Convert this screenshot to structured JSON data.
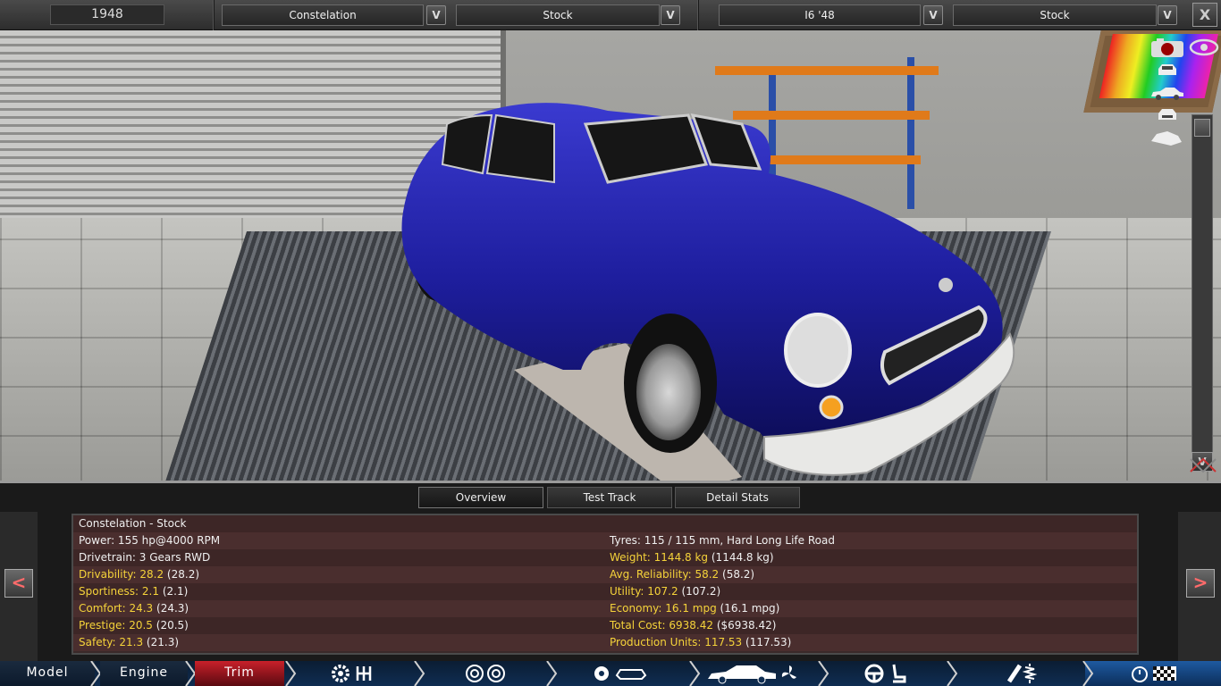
{
  "topbar": {
    "year": "1948",
    "model": "Constelation",
    "model_trim": "Stock",
    "engine": "I6 '48",
    "engine_variant": "Stock",
    "dropdown_glyph": "V",
    "close_glyph": "X"
  },
  "camera_tools": {
    "icons": [
      "camera-icon",
      "car-front-view-icon",
      "car-side-view-icon",
      "car-rear-view-icon",
      "car-angled-view-icon"
    ],
    "scroll_down": "V"
  },
  "tabs": [
    "Overview",
    "Test Track",
    "Detail Stats"
  ],
  "active_tab": "Overview",
  "nav_prev": "<",
  "nav_next": ">",
  "stats": {
    "title": "Constelation - Stock",
    "left": [
      {
        "label": "Power: 155 hp@4000 RPM",
        "value": "",
        "highlight": false
      },
      {
        "label": "Drivetrain: 3 Gears RWD",
        "value": "",
        "highlight": false
      },
      {
        "label": "Drivability: 28.2",
        "value": "(28.2)",
        "highlight": true
      },
      {
        "label": "Sportiness: 2.1",
        "value": "(2.1)",
        "highlight": true
      },
      {
        "label": "Comfort: 24.3",
        "value": "(24.3)",
        "highlight": true
      },
      {
        "label": "Prestige: 20.5",
        "value": "(20.5)",
        "highlight": true
      },
      {
        "label": "Safety: 21.3",
        "value": "(21.3)",
        "highlight": true
      }
    ],
    "right": [
      {
        "label": "Tyres: 115 / 115 mm, Hard Long Life Road",
        "value": "",
        "highlight": false
      },
      {
        "label": "Weight: 1144.8 kg",
        "value": "(1144.8 kg)",
        "highlight": true
      },
      {
        "label": "Avg. Reliability: 58.2",
        "value": "(58.2)",
        "highlight": true
      },
      {
        "label": "Utility: 107.2",
        "value": "(107.2)",
        "highlight": true
      },
      {
        "label": "Economy: 16.1 mpg",
        "value": "(16.1 mpg)",
        "highlight": true
      },
      {
        "label": "Total Cost: 6938.42",
        "value": "($6938.42)",
        "highlight": true
      },
      {
        "label": "Production Units: 117.53",
        "value": "(117.53)",
        "highlight": true
      }
    ]
  },
  "nav": {
    "tabs": [
      "Model",
      "Engine",
      "Trim"
    ],
    "active": "Trim",
    "icon_groups": [
      [
        "gear-icon",
        "gearbox-icon"
      ],
      [
        "wheel-icon",
        "wheel-icon"
      ],
      [
        "brake-icon",
        "chassis-icon"
      ],
      [
        "car-body-icon",
        "fan-icon"
      ],
      [
        "steering-wheel-icon",
        "seat-icon"
      ],
      [
        "exhaust-icon",
        "suspension-icon"
      ],
      [
        "timer-icon",
        "checkered-flag-icon"
      ]
    ]
  },
  "colors": {
    "car_body": "#1e1e9e",
    "highlight_text": "#f5d33a",
    "active_nav": "#b5121b",
    "nav_bg": "#0f2d52"
  }
}
